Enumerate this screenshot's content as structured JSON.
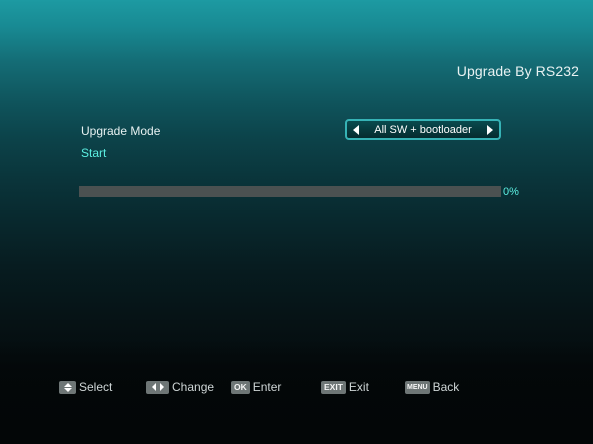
{
  "header": {
    "title": "Upgrade By RS232"
  },
  "form": {
    "upgrade_mode_label": "Upgrade Mode",
    "upgrade_mode_value": "All SW + bootloader",
    "start_label": "Start"
  },
  "progress": {
    "percent": 0,
    "text": "0%"
  },
  "footer": {
    "select_label": "Select",
    "change_label": "Change",
    "ok_key": "OK",
    "enter_label": "Enter",
    "exit_key": "EXIT",
    "exit_label": "Exit",
    "menu_key": "MENU",
    "back_label": "Back"
  },
  "colors": {
    "accent": "#36b3b6",
    "highlight_text": "#5cf0e2",
    "progress_track": "#4b5151"
  },
  "icons": {
    "select": "up-down-arrows-icon",
    "change": "left-right-arrows-icon",
    "mode_prev": "arrow-left-icon",
    "mode_next": "arrow-right-icon"
  }
}
